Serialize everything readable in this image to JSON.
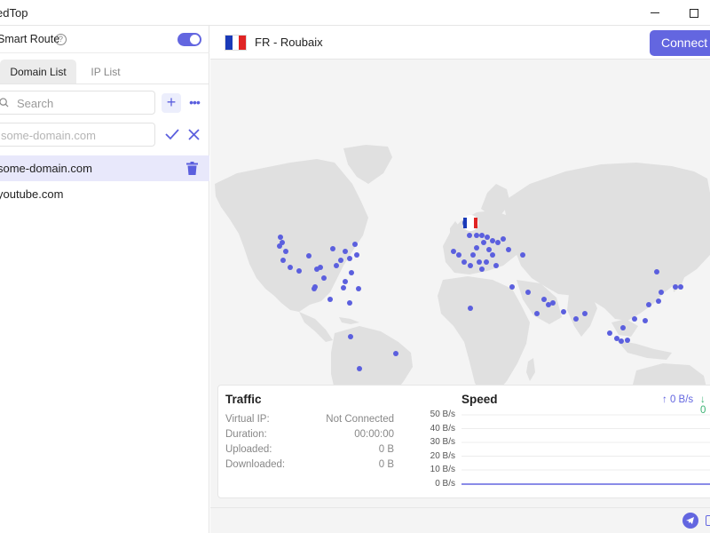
{
  "window": {
    "title": "edTop"
  },
  "sidebar": {
    "smart_route_label": "Smart Route",
    "smart_route_enabled": true,
    "tabs": [
      {
        "label": "Domain List",
        "active": true
      },
      {
        "label": "IP List",
        "active": false
      }
    ],
    "search_placeholder": "Search",
    "domain_input_placeholder": "some-domain.com",
    "domains": [
      {
        "name": "some-domain.com",
        "selected": true
      },
      {
        "name": "youtube.com",
        "selected": false
      }
    ]
  },
  "header": {
    "server": "FR - Roubaix",
    "connect_label": "Connect"
  },
  "traffic": {
    "title": "Traffic",
    "rows": [
      {
        "label": "Virtual IP:",
        "value": "Not Connected"
      },
      {
        "label": "Duration:",
        "value": "00:00:00"
      },
      {
        "label": "Uploaded:",
        "value": "0 B"
      },
      {
        "label": "Downloaded:",
        "value": "0 B"
      }
    ]
  },
  "speed": {
    "title": "Speed",
    "up": "↑ 0 B/s",
    "down": "↓ 0",
    "ticks": [
      "50 B/s",
      "40 B/s",
      "30 B/s",
      "20 B/s",
      "10 B/s",
      "0 B/s"
    ]
  },
  "colors": {
    "accent": "#6366e0",
    "land": "#e0e0e0",
    "server_dot": "#5b5fde",
    "selected_row": "#e8e8fb"
  },
  "icons": {
    "help": "question-circle-icon",
    "search": "search-icon",
    "add": "plus-icon",
    "more": "more-dots-icon",
    "confirm": "check-icon",
    "cancel": "close-icon",
    "delete": "trash-icon",
    "flag": "france-flag-icon",
    "telegram": "telegram-icon"
  }
}
